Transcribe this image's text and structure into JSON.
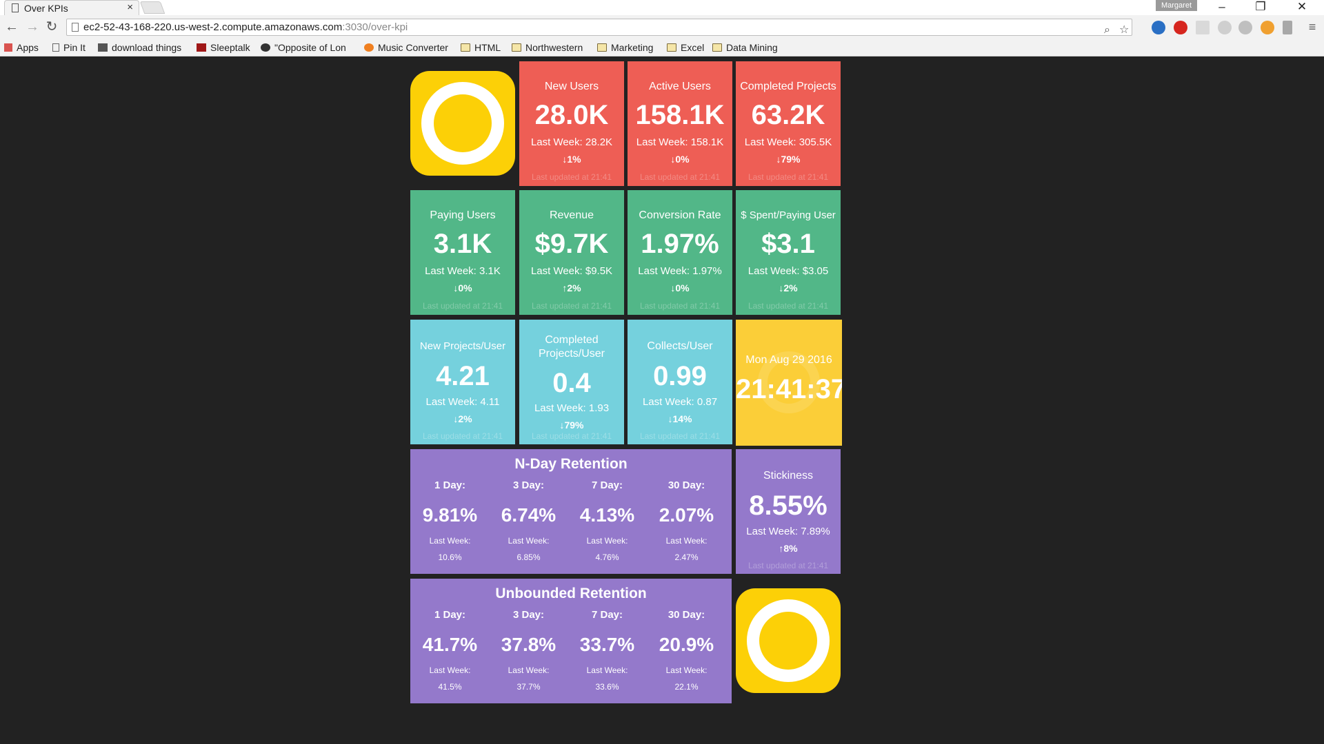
{
  "browser": {
    "tab_title": "Over KPIs",
    "tab_close": "×",
    "profile": "Margaret",
    "url_host": "ec2-52-43-168-220.us-west-2.compute.amazonaws.com",
    "url_path": ":3030/over-kpi",
    "bookmarks": [
      "Apps",
      "Pin It",
      "download things",
      "Sleeptalk",
      "\"Opposite of Lon",
      "Music Converter",
      "HTML",
      "Northwestern",
      "Marketing",
      "Excel",
      "Data Mining"
    ]
  },
  "kpis": {
    "new_users": {
      "title": "New Users",
      "value": "28.0K",
      "last": "Last Week: 28.2K",
      "change": "1%",
      "dir": "down",
      "updated": "Last updated at 21:41"
    },
    "active_users": {
      "title": "Active Users",
      "value": "158.1K",
      "last": "Last Week: 158.1K",
      "change": "0%",
      "dir": "down",
      "updated": "Last updated at 21:41"
    },
    "completed_projects": {
      "title": "Completed Projects",
      "value": "63.2K",
      "last": "Last Week: 305.5K",
      "change": "79%",
      "dir": "down",
      "updated": "Last updated at 21:41"
    },
    "paying_users": {
      "title": "Paying Users",
      "value": "3.1K",
      "last": "Last Week: 3.1K",
      "change": "0%",
      "dir": "down",
      "updated": "Last updated at 21:41"
    },
    "revenue": {
      "title": "Revenue",
      "value": "$9.7K",
      "last": "Last Week: $9.5K",
      "change": "2%",
      "dir": "up",
      "updated": "Last updated at 21:41"
    },
    "conversion_rate": {
      "title": "Conversion Rate",
      "value": "1.97%",
      "last": "Last Week: 1.97%",
      "change": "0%",
      "dir": "down",
      "updated": "Last updated at 21:41"
    },
    "spent_per_paying_user": {
      "title": "$ Spent/Paying User",
      "value": "$3.1",
      "last": "Last Week: $3.05",
      "change": "2%",
      "dir": "down",
      "updated": "Last updated at 21:41"
    },
    "new_projects_per_user": {
      "title": "New Projects/User",
      "value": "4.21",
      "last": "Last Week: 4.11",
      "change": "2%",
      "dir": "down",
      "updated": "Last updated at 21:41"
    },
    "completed_projects_per_user": {
      "title_line1": "Completed",
      "title_line2": "Projects/User",
      "value": "0.4",
      "last": "Last Week: 1.93",
      "change": "79%",
      "dir": "down",
      "updated": "Last updated at 21:41"
    },
    "collects_per_user": {
      "title": "Collects/User",
      "value": "0.99",
      "last": "Last Week: 0.87",
      "change": "14%",
      "dir": "down",
      "updated": "Last updated at 21:41"
    },
    "stickiness": {
      "title": "Stickiness",
      "value": "8.55%",
      "last": "Last Week: 7.89%",
      "change": "8%",
      "dir": "up",
      "updated": "Last updated at 21:41"
    }
  },
  "clock": {
    "date": "Mon Aug 29 2016",
    "time": "21:41:37"
  },
  "nday_retention": {
    "title": "N-Day Retention",
    "last_week_label": "Last Week:",
    "columns": [
      {
        "label": "1 Day:",
        "value": "9.81%",
        "last": "10.6%"
      },
      {
        "label": "3 Day:",
        "value": "6.74%",
        "last": "6.85%"
      },
      {
        "label": "7 Day:",
        "value": "4.13%",
        "last": "4.76%"
      },
      {
        "label": "30 Day:",
        "value": "2.07%",
        "last": "2.47%"
      }
    ]
  },
  "unbounded_retention": {
    "title": "Unbounded Retention",
    "last_week_label": "Last Week:",
    "columns": [
      {
        "label": "1 Day:",
        "value": "41.7%",
        "last": "41.5%"
      },
      {
        "label": "3 Day:",
        "value": "37.8%",
        "last": "37.7%"
      },
      {
        "label": "7 Day:",
        "value": "33.7%",
        "last": "33.6%"
      },
      {
        "label": "30 Day:",
        "value": "20.9%",
        "last": "22.1%"
      }
    ]
  },
  "arrows": {
    "up": "🡅",
    "down": "🡇"
  },
  "colors": {
    "red": "#ee5e55",
    "green": "#52b788",
    "cyan": "#75d1dd",
    "yellow": "#fbce38",
    "purple": "#9479cb",
    "logo": "#fcd007",
    "background": "#222222"
  }
}
